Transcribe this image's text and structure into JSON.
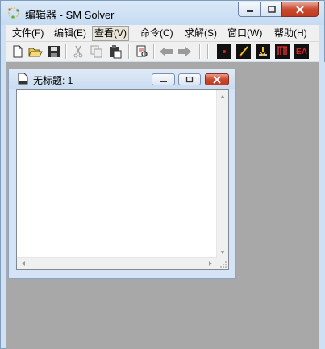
{
  "app": {
    "title": "编辑器 - SM Solver"
  },
  "menu": [
    {
      "label": "文件(F)"
    },
    {
      "label": "编辑(E)"
    },
    {
      "label": "查看(V)"
    },
    {
      "label": "命令(C)"
    },
    {
      "label": "求解(S)"
    },
    {
      "label": "窗口(W)"
    },
    {
      "label": "帮助(H)"
    }
  ],
  "active_menu": "查看(V)",
  "toolbar_icons": [
    "new-document-icon",
    "open-folder-icon",
    "save-icon",
    "cut-icon",
    "copy-icon",
    "paste-icon",
    "print-preview-icon",
    "back-arrow-icon",
    "forward-arrow-icon",
    "red-dot-icon",
    "pencil-line-icon",
    "node-fix-icon",
    "load-arrows-icon",
    "ea-icon"
  ],
  "ea_label": "EA",
  "document": {
    "title": "无标题: 1"
  },
  "colors": {
    "close_red": "#c94a30",
    "client_gray": "#a8a8a8",
    "title_blue": "#cfe0f4"
  }
}
